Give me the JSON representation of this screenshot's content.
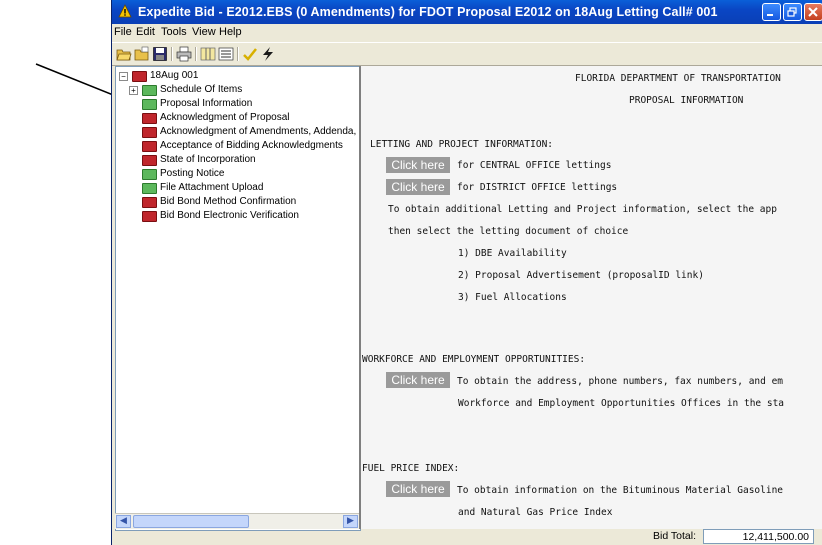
{
  "window": {
    "title": "Expedite Bid - E2012.EBS (0 Amendments) for FDOT Proposal E2012 on 18Aug Letting Call# 001",
    "colors": {
      "titlebar": "#0a46c4",
      "folder_red": "#c0262c",
      "folder_green": "#5cb85c",
      "click_here_bg": "#9a9a9a"
    }
  },
  "menu": [
    "File",
    "Edit",
    "Tools",
    "View",
    "Help"
  ],
  "toolbar_icons": [
    "open-folder-icon",
    "open-icon",
    "save-icon",
    "print-icon",
    "columns-icon",
    "list-icon",
    "checkmark-icon",
    "lightning-icon"
  ],
  "tree": {
    "root": "18Aug 001",
    "items": [
      {
        "label": "Schedule Of Items",
        "color": "green",
        "expander": "+"
      },
      {
        "label": "Proposal Information",
        "color": "green"
      },
      {
        "label": "Acknowledgment of Proposal",
        "color": "red"
      },
      {
        "label": "Acknowledgment of Amendments, Addenda,",
        "color": "red"
      },
      {
        "label": "Acceptance of Bidding Acknowledgments",
        "color": "red"
      },
      {
        "label": "State of Incorporation",
        "color": "red"
      },
      {
        "label": "Posting Notice",
        "color": "green"
      },
      {
        "label": "File Attachment Upload",
        "color": "green"
      },
      {
        "label": "Bid Bond Method Confirmation",
        "color": "red"
      },
      {
        "label": "Bid Bond Electronic Verification",
        "color": "red"
      }
    ]
  },
  "content": {
    "header1": "FLORIDA DEPARTMENT OF TRANSPORTATION",
    "header2": "PROPOSAL INFORMATION",
    "section1_title": "LETTING AND PROJECT INFORMATION:",
    "click_here": "Click here",
    "central": "for CENTRAL OFFICE lettings",
    "district": "for DISTRICT OFFICE lettings",
    "obtain_line": "To obtain additional Letting and Project information, select the app",
    "select_line": "then select the letting document of choice",
    "list": [
      "1) DBE Availability",
      "2) Proposal Advertisement (proposalID link)",
      "3) Fuel Allocations"
    ],
    "section2_title": "WORKFORCE AND EMPLOYMENT OPPORTUNITIES:",
    "workforce_line1": "To obtain the address, phone numbers, fax numbers, and em",
    "workforce_line2": "Workforce and Employment Opportunities Offices in the sta",
    "section3_title": "FUEL PRICE INDEX:",
    "fuel_line1": "To obtain information on the Bituminous Material Gasoline",
    "fuel_line2": "and Natural Gas Price Index"
  },
  "status": {
    "bid_total_label": "Bid Total:",
    "bid_total_value": "12,411,500.00"
  }
}
